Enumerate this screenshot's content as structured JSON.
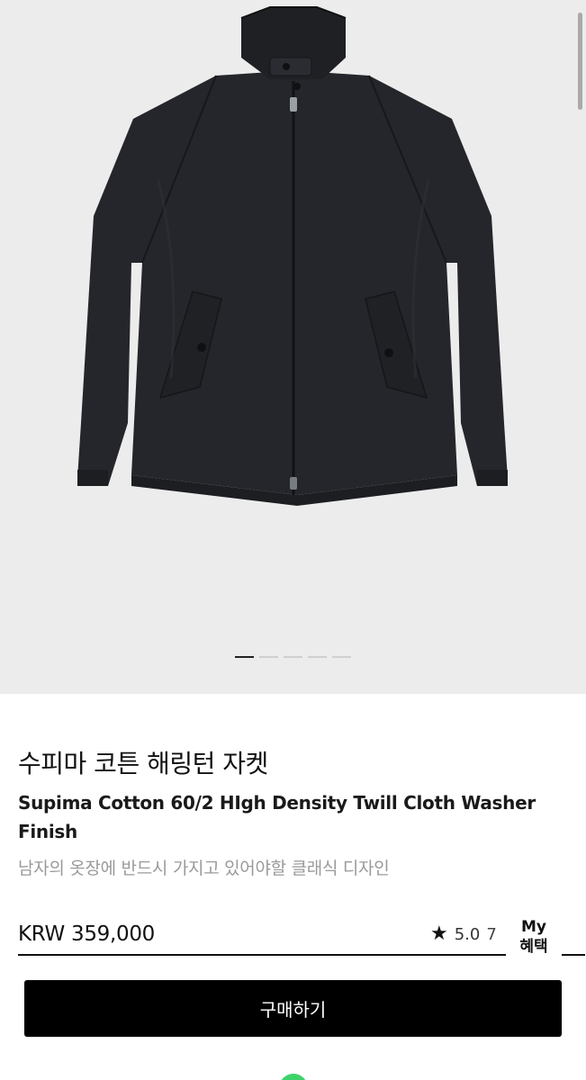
{
  "product": {
    "title_ko": "수피마 코튼 해링턴 자켓",
    "title_en": "Supima Cotton 60/2 HIgh Density Twill Cloth Washer Finish",
    "subtitle": "남자의 옷장에 반드시 가지고 있어야할 클래식 디자인",
    "price": "KRW 359,000",
    "rating": "5.0",
    "rating_more": "7"
  },
  "gallery": {
    "total_images": 5,
    "active_index": 0,
    "image_subject": "jacket-image"
  },
  "floating": {
    "my_label": "My",
    "benefit_label": "혜택"
  },
  "actions": {
    "buy_label": "구매하기"
  },
  "colors": {
    "jacket": "#24262b",
    "background": "#ececec",
    "button": "#000000",
    "chat": "#3dd36a"
  }
}
